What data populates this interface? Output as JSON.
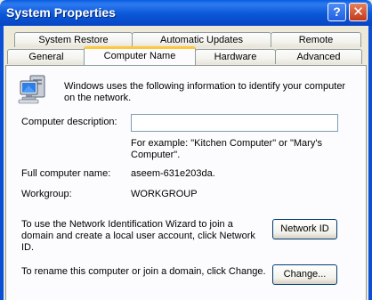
{
  "window": {
    "title": "System Properties",
    "help_glyph": "?",
    "close_glyph": "✕"
  },
  "tabs": {
    "row_back": [
      "System Restore",
      "Automatic Updates",
      "Remote"
    ],
    "row_front": [
      "General",
      "Computer Name",
      "Hardware",
      "Advanced"
    ],
    "active": "Computer Name"
  },
  "computer_name": {
    "intro_line1": "Windows uses the following information to identify your computer",
    "intro_line2": "on the network.",
    "description_label": "Computer description:",
    "description_value": "",
    "example_line1": "For example: \"Kitchen Computer\" or \"Mary's",
    "example_line2": "Computer\".",
    "full_name_label": "Full computer name:",
    "full_name_value": "aseem-631e203da.",
    "workgroup_label": "Workgroup:",
    "workgroup_value": "WORKGROUP",
    "wizard_line1": "To use the Network Identification Wizard to join a",
    "wizard_line2": "domain and create a local user account, click Network",
    "wizard_line3": "ID.",
    "network_id_button": "Network ID",
    "rename_text": "To rename this computer or join a domain, click Change.",
    "change_button": "Change..."
  },
  "colors": {
    "titlebar": "#0a5de0",
    "dialog_bg": "#ece9d8",
    "panel_bg": "#fcfcfe",
    "active_tab_accent": "#ffc83c"
  }
}
